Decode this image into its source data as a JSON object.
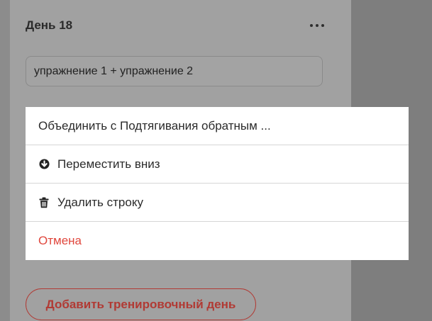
{
  "day_card": {
    "title": "День 18",
    "exercise_value": "упражнение 1 + упражнение 2",
    "add_day_label": "Добавить тренировочный день"
  },
  "action_sheet": {
    "items": [
      {
        "label": "Объединить с Подтягивания обратным ...",
        "icon": ""
      },
      {
        "label": "Переместить вниз",
        "icon": "arrow-down-circle-icon"
      },
      {
        "label": "Удалить строку",
        "icon": "trash-icon"
      },
      {
        "label": "Отмена",
        "icon": ""
      }
    ]
  },
  "colors": {
    "overlay": "#7e7e7e",
    "accent": "#b13a34",
    "cancel": "#e0473d",
    "sheet_bg": "#ffffff"
  }
}
